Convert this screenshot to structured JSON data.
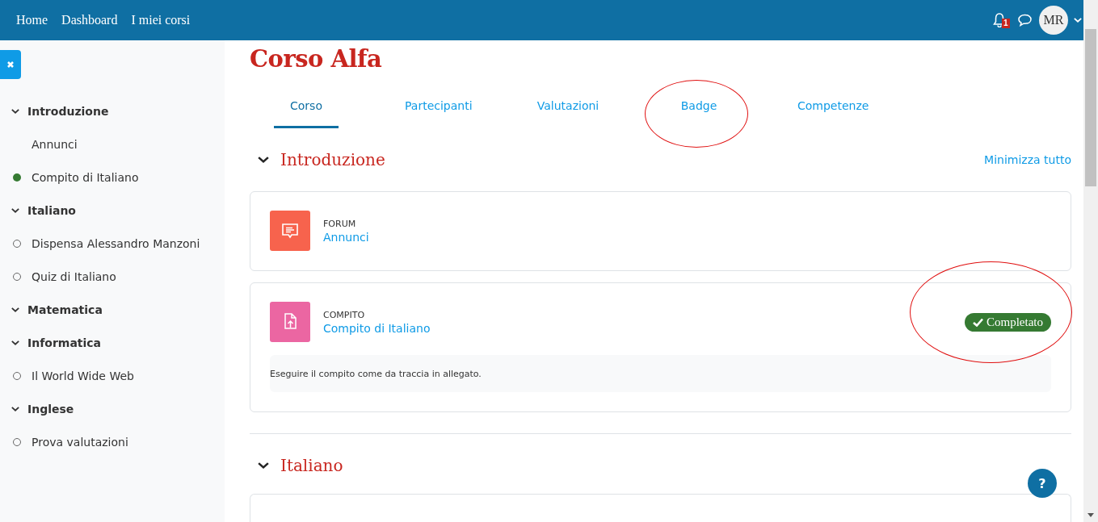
{
  "navbar": {
    "links": [
      {
        "label": "Home"
      },
      {
        "label": "Dashboard"
      },
      {
        "label": "I miei corsi"
      }
    ],
    "notification_count": "1",
    "avatar_initials": "MR"
  },
  "drawer_close": {
    "selected": true
  },
  "sidebar": {
    "items": [
      {
        "kind": "section",
        "label": "Introduzione",
        "expanded": true
      },
      {
        "kind": "item",
        "label": "Annunci",
        "tracked": false
      },
      {
        "kind": "item",
        "label": "Compito di Italiano",
        "tracked": true,
        "completed": true
      },
      {
        "kind": "section",
        "label": "Italiano",
        "expanded": true
      },
      {
        "kind": "item",
        "label": "Dispensa Alessandro Manzoni",
        "tracked": true,
        "completed": false
      },
      {
        "kind": "item",
        "label": "Quiz di Italiano",
        "tracked": true,
        "completed": false
      },
      {
        "kind": "section",
        "label": "Matematica",
        "expanded": true
      },
      {
        "kind": "section",
        "label": "Informatica",
        "expanded": true
      },
      {
        "kind": "item",
        "label": "Il World Wide Web",
        "tracked": true,
        "completed": false
      },
      {
        "kind": "section",
        "label": "Inglese",
        "expanded": true
      },
      {
        "kind": "item",
        "label": "Prova valutazioni",
        "tracked": true,
        "completed": false
      }
    ]
  },
  "course_title": "Corso Alfa",
  "tabs": [
    {
      "label": "Corso",
      "selected": true,
      "circled": false
    },
    {
      "label": "Partecipanti",
      "selected": false,
      "circled": false
    },
    {
      "label": "Valutazioni",
      "selected": false,
      "circled": false
    },
    {
      "label": "Badge",
      "selected": false,
      "circled": true
    },
    {
      "label": "Competenze",
      "selected": false,
      "circled": false
    }
  ],
  "collapse_all": "Minimizza tutto",
  "sections": [
    {
      "title": "Introduzione",
      "expanded": true,
      "activities": [
        {
          "kind": "forum",
          "type_label": "FORUM",
          "name": "Annunci"
        },
        {
          "kind": "assign",
          "type_label": "COMPITO",
          "name": "Compito di Italiano",
          "completion": "Completato",
          "circled": true,
          "description": "Eseguire il compito come da traccia in allegato."
        }
      ]
    },
    {
      "title": "Italiano",
      "expanded": true
    }
  ],
  "help_button": "?"
}
